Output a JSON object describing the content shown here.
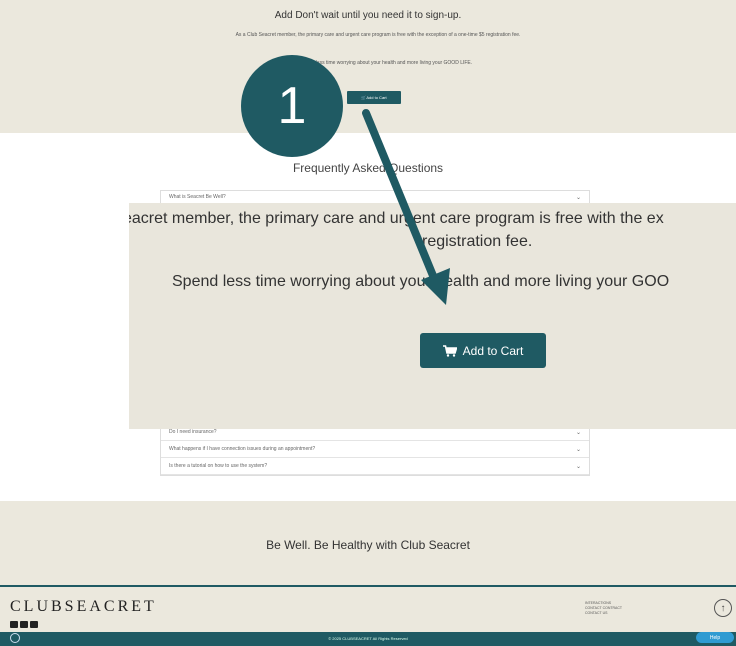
{
  "signup": {
    "title": "Add Don't wait until you need it to sign-up.",
    "description": "As a Club Seacret member, the primary care and urgent care program is free with the exception of a one-time $5 registration fee.",
    "spend": "Spend less time worrying about your health and more living your GOOD LIFE.",
    "mini_cart_label": "Add to Cart"
  },
  "faq": {
    "heading": "Frequently Asked Questions",
    "top_items": [
      "What is Seacret Be Well?"
    ],
    "bottom_items": [
      "Do I need insurance?",
      "What happens if I have connection issues during an appointment?",
      "Is there a tutorial on how to use the system?"
    ]
  },
  "zoom": {
    "line1": "eacret member, the primary care and urgent care program is free with the ex",
    "line2": "registration fee.",
    "line3": "Spend less time worrying about your health and more living your GOO",
    "cart_label": "Add to Cart"
  },
  "marker": {
    "number": "1"
  },
  "tagline": "Be Well. Be Healthy with Club Seacret",
  "footer": {
    "logo": "CLUBSEACRET",
    "links": [
      "INTERACTIONS",
      "CONTACT CONTRACT",
      "CONTACT US"
    ],
    "up_label": "↑",
    "copyright": "© 2025 CLUBSEACRET All Rights Reserved",
    "help_label": "Help"
  },
  "colors": {
    "brand": "#1f5a63",
    "background": "#ebe8dd",
    "help": "#2f9bd2"
  }
}
